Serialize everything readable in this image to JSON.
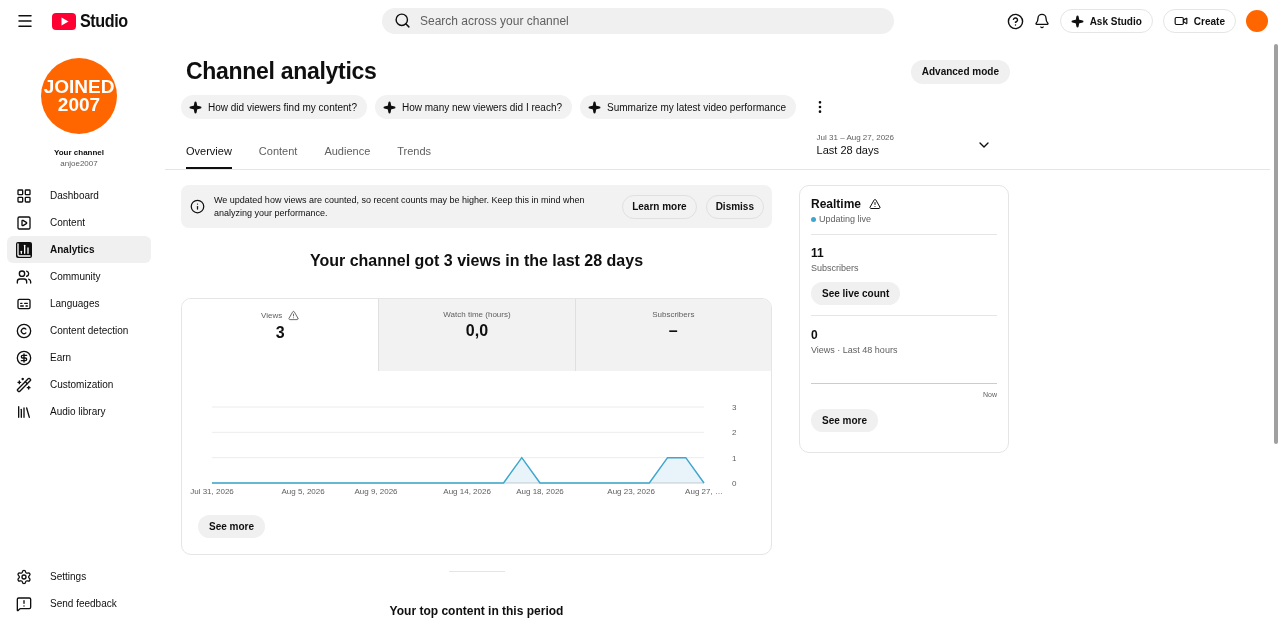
{
  "top_bar": {
    "logo_text": "Studio",
    "search": {
      "placeholder": "Search across your channel"
    },
    "buttons": [
      {
        "kind": "ask",
        "label": "Ask Studio"
      },
      {
        "kind": "create",
        "label": "Create"
      }
    ]
  },
  "sidebar": {
    "channel_avatar_lines": [
      "JOINED",
      "2007"
    ],
    "channel_label": "Your channel",
    "channel_handle": "anjoe2007",
    "items": [
      {
        "label": "Dashboard",
        "selected": false
      },
      {
        "label": "Content",
        "selected": false
      },
      {
        "label": "Analytics",
        "selected": true
      },
      {
        "label": "Community",
        "selected": false
      },
      {
        "label": "Languages",
        "selected": false
      },
      {
        "label": "Content detection",
        "selected": false
      },
      {
        "label": "Earn",
        "selected": false
      },
      {
        "label": "Customization",
        "selected": false
      },
      {
        "label": "Audio library",
        "selected": false
      }
    ],
    "footer_items": [
      {
        "label": "Settings"
      },
      {
        "label": "Send feedback"
      }
    ]
  },
  "page": {
    "title": "Channel analytics",
    "advanced_button": "Advanced mode",
    "prompts": [
      "How did viewers find my content?",
      "How many new viewers did I reach?",
      "Summarize my latest video performance"
    ],
    "tabs": [
      {
        "label": "Overview",
        "selected": true
      },
      {
        "label": "Content",
        "selected": false
      },
      {
        "label": "Audience",
        "selected": false
      },
      {
        "label": "Trends",
        "selected": false
      }
    ],
    "date_range": {
      "dates": "Jul 31 – Aug 27, 2026",
      "label": "Last 28 days"
    },
    "notice": {
      "text": "We updated how views are counted, so recent counts may be higher. Keep this in mind when analyzing your performance.",
      "buttons": [
        "Learn more",
        "Dismiss"
      ]
    },
    "headline": "Your channel got 3 views in the last 28 days",
    "metrics": [
      {
        "label": "Views",
        "value": "3",
        "warning": true,
        "selected": true
      },
      {
        "label": "Watch time (hours)",
        "value": "0,0",
        "warning": false,
        "selected": false
      },
      {
        "label": "Subscribers",
        "value": "–",
        "warning": false,
        "selected": false
      }
    ],
    "chart_data": {
      "type": "area",
      "categories": [
        "Jul 31, 2026",
        null,
        null,
        null,
        null,
        "Aug 5, 2026",
        null,
        null,
        null,
        "Aug 9, 2026",
        null,
        null,
        null,
        null,
        "Aug 14, 2026",
        null,
        null,
        null,
        "Aug 18, 2026",
        null,
        null,
        null,
        null,
        "Aug 23, 2026",
        null,
        null,
        null,
        "Aug 27, …"
      ],
      "series": [
        {
          "color": "#3ea6cf",
          "values": [
            0,
            0,
            0,
            0,
            0,
            0,
            0,
            0,
            0,
            0,
            0,
            0,
            0,
            0,
            0,
            0,
            0,
            1,
            0,
            0,
            0,
            0,
            0,
            0,
            0,
            1,
            1,
            0
          ]
        }
      ],
      "ylim": [
        0,
        3
      ],
      "yticks": [
        0,
        1,
        2,
        3
      ]
    },
    "see_more": "See more",
    "top_content_title": "Your top content in this period"
  },
  "realtime": {
    "title": "Realtime",
    "status": "Updating live",
    "subscribers": {
      "value": "11",
      "label": "Subscribers",
      "button": "See live count"
    },
    "views": {
      "value": "0",
      "label": "Views · Last 48 hours"
    },
    "axis_label": "Now",
    "see_more": "See more"
  }
}
